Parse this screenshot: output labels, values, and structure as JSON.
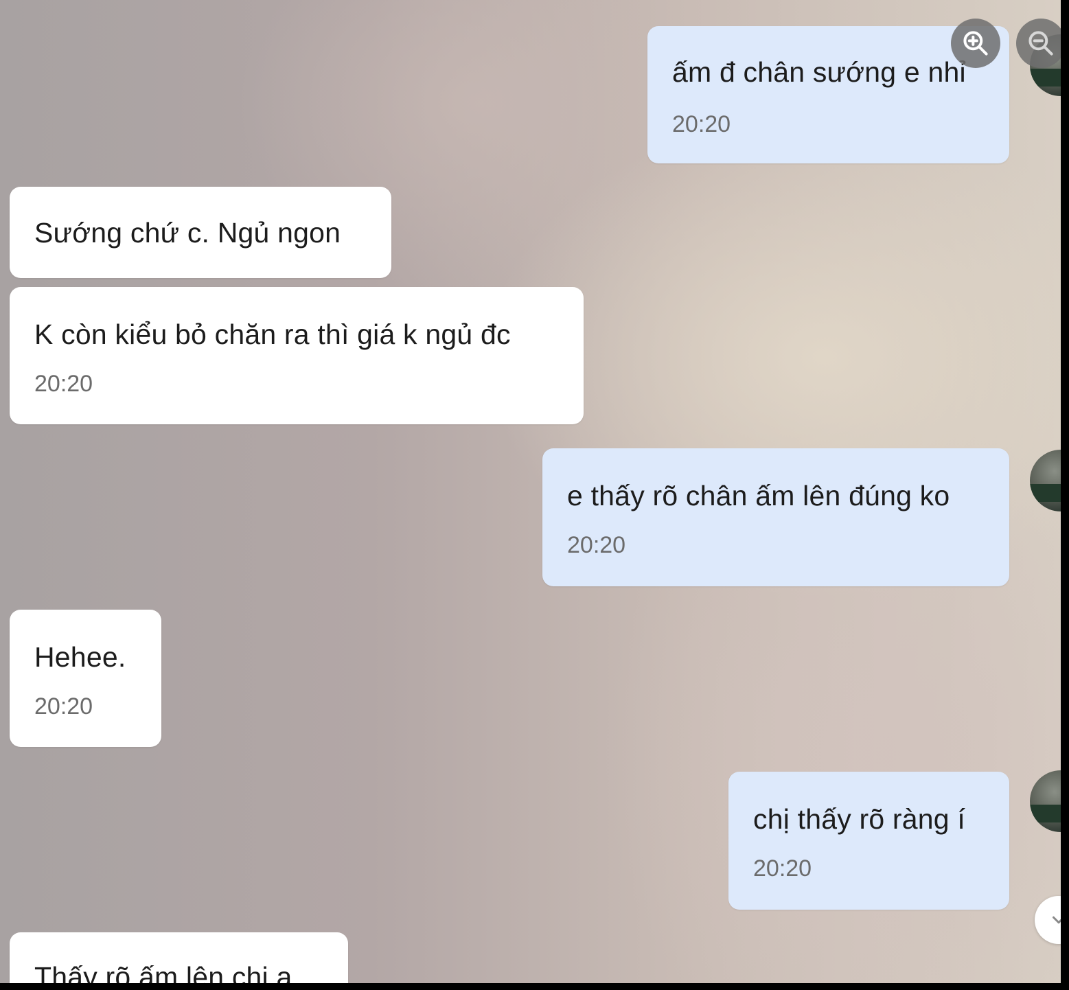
{
  "messages": [
    {
      "side": "sent",
      "text": "ấm đ chân sướng e nhỉ",
      "time": "20:20"
    },
    {
      "side": "received",
      "text": "Sướng chứ c. Ngủ ngon",
      "time": ""
    },
    {
      "side": "received",
      "text": "K còn kiểu bỏ chăn ra thì giá k ngủ đc",
      "time": "20:20"
    },
    {
      "side": "sent",
      "text": "e thấy rõ chân ấm lên đúng ko",
      "time": "20:20"
    },
    {
      "side": "received",
      "text": "Hehee.",
      "time": "20:20"
    },
    {
      "side": "sent",
      "text": "chị thấy rõ ràng í",
      "time": "20:20"
    },
    {
      "side": "received",
      "text": "Thấy rõ ấm lên chị a",
      "time": ""
    }
  ],
  "controls": {
    "zoom_in_icon": "zoom-in-icon",
    "zoom_out_icon": "zoom-out-icon",
    "scroll_down_icon": "chevron-down-icon"
  },
  "colors": {
    "sent_bubble": "#dde9fb",
    "received_bubble": "#ffffff",
    "timestamp": "#6b6b6b"
  }
}
